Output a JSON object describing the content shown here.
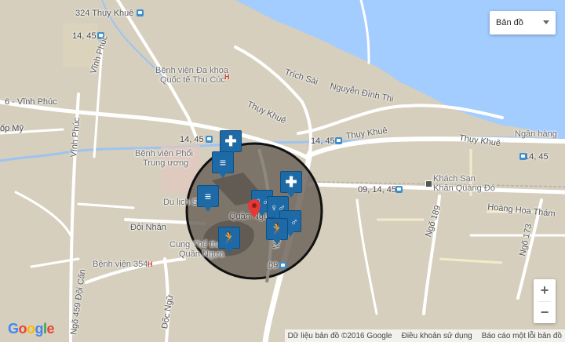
{
  "map_type_control": {
    "selected": "Bản đồ"
  },
  "zoom": {
    "in": "+",
    "out": "−"
  },
  "footer": {
    "data_credit": "Dữ liệu bản đồ ©2016 Google",
    "terms": "Điều khoản sử dụng",
    "report": "Báo cáo một lỗi bản đồ"
  },
  "logo": {
    "letters": [
      "G",
      "o",
      "o",
      "g",
      "l",
      "e"
    ],
    "colors": [
      "#4285f4",
      "#ea4335",
      "#fbbc05",
      "#4285f4",
      "#34a853",
      "#ea4335"
    ]
  },
  "labels": {
    "thuy_khue_top": "324 Thụy Khuê",
    "bus_14_45_a": "14, 45",
    "vinh_phuc_road": "Vĩnh Phúc",
    "vinh_phuc": "6 - Vĩnh Phúc",
    "hospital_thu_cuc_1": "Bệnh viện Đa khoa",
    "hospital_thu_cuc_2": "Quốc tế Thu Cúc",
    "trich_sai": "Trích Sài",
    "nguyen_dinh_thi": "Nguyễn Đình Thi",
    "thuy_khue_mid": "Thụy Khuê",
    "op_my": "ốp Mỹ",
    "vinh_phuc_road2": "Vĩnh Phúc",
    "bus_14_45_b": "14, 45",
    "bus_14_45_c": "14, 45",
    "thuy_khue_road": "Thụy Khuê",
    "thuy_khue_right": "Thụy Khuê",
    "ngan_hang": "Ngân hàng",
    "bus_14_45_d": "14, 45",
    "hospital_phoi_1": "Bệnh viện Phổi",
    "hospital_phoi_2": "Trung ương",
    "du_lich": "Du lịch S",
    "khach_san_1": "Khách Sạn",
    "khach_san_2": "Khăn Quàng Đỏ",
    "bus_09_14_45": "09, 14, 45",
    "hoang_hoa_tham": "Hoàng Hoa Thám",
    "quan_ngua": "Quần Ngựa",
    "doi_nhan": "Đội Nhân",
    "ngo_189": "Ngõ 189",
    "ngo_173": "Ngõ 173",
    "cung_the_thao_1": "Cung Thể thao",
    "cung_the_thao_2": "Quần Ngựa",
    "hospital_354": "Bệnh viện 354",
    "bus_09": "09",
    "ngo_459": "Ngõ 459 Đội Cấn",
    "doc_ngu": "Dốc Ngữ",
    "ve": "Vă"
  }
}
